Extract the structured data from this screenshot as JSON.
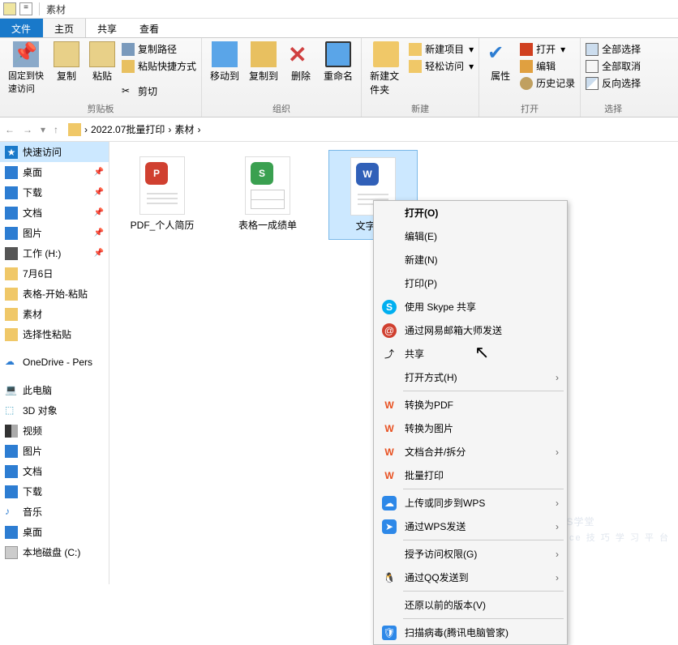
{
  "window": {
    "title": "素材"
  },
  "tabs": {
    "file": "文件",
    "home": "主页",
    "share": "共享",
    "view": "查看"
  },
  "ribbon": {
    "pin": "固定到快速访问",
    "copy": "复制",
    "paste": "粘贴",
    "cut": "剪切",
    "copy_path": "复制路径",
    "paste_shortcut": "粘贴快捷方式",
    "clipboard": "剪贴板",
    "move_to": "移动到",
    "copy_to": "复制到",
    "delete": "删除",
    "rename": "重命名",
    "organize": "组织",
    "new_folder": "新建文件夹",
    "new_item": "新建项目",
    "easy_access": "轻松访问",
    "new": "新建",
    "properties": "属性",
    "open": "打开",
    "edit": "编辑",
    "history": "历史记录",
    "open_group": "打开",
    "select_all": "全部选择",
    "select_none": "全部取消",
    "invert": "反向选择",
    "select": "选择"
  },
  "breadcrumb": {
    "parent": "2022.07批量打印",
    "current": "素材",
    "sep": "›"
  },
  "sidebar": {
    "quick_access": "快速访问",
    "desktop": "桌面",
    "downloads": "下载",
    "documents": "文档",
    "pictures": "图片",
    "work_h": "工作 (H:)",
    "july6": "7月6日",
    "table_start": "表格-开始-粘贴",
    "material": "素材",
    "selective_paste": "选择性粘贴",
    "onedrive": "OneDrive - Pers",
    "this_pc": "此电脑",
    "objects_3d": "3D 对象",
    "videos": "视频",
    "pictures2": "图片",
    "documents2": "文档",
    "downloads2": "下载",
    "music": "音乐",
    "desktop2": "桌面",
    "local_disk_c": "本地磁盘 (C:)"
  },
  "files": [
    {
      "name": "PDF_个人简历",
      "icon_color": "#d04030"
    },
    {
      "name": "表格一成绩单",
      "icon_color": "#3aa050"
    },
    {
      "name": "文字_个",
      "icon_color": "#3060b8"
    }
  ],
  "context_menu": {
    "open": "打开(O)",
    "edit": "编辑(E)",
    "new": "新建(N)",
    "print": "打印(P)",
    "skype": "使用 Skype 共享",
    "netease": "通过网易邮箱大师发送",
    "share": "共享",
    "open_with": "打开方式(H)",
    "to_pdf": "转换为PDF",
    "to_image": "转换为图片",
    "merge_split": "文档合并/拆分",
    "batch_print": "批量打印",
    "upload_wps": "上传或同步到WPS",
    "send_wps": "通过WPS发送",
    "grant_access": "授予访问权限(G)",
    "send_qq": "通过QQ发送到",
    "restore": "还原以前的版本(V)",
    "scan": "扫描病毒(腾讯电脑管家)"
  },
  "watermark": {
    "main": "WPS学堂",
    "sub": "Office 技 巧 学 习 平 台"
  }
}
